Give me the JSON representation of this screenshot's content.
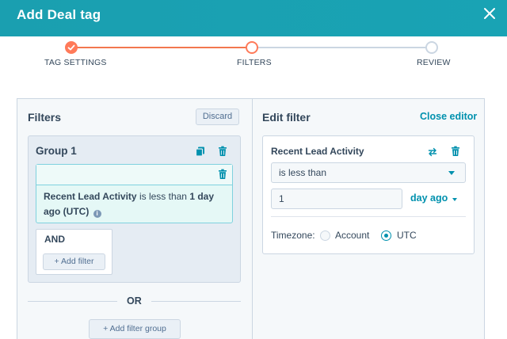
{
  "dialog": {
    "title": "Add Deal tag"
  },
  "stepper": {
    "steps": [
      {
        "label": "TAG SETTINGS",
        "state": "complete"
      },
      {
        "label": "FILTERS",
        "state": "active"
      },
      {
        "label": "REVIEW",
        "state": "upcoming"
      }
    ]
  },
  "filters_panel": {
    "title": "Filters",
    "discard_label": "Discard",
    "group": {
      "title": "Group 1",
      "filter": {
        "property": "Recent Lead Activity",
        "operator_text": "is less than",
        "value_text": "1 day ago (UTC)"
      },
      "and_label": "AND",
      "add_filter_label": "+ Add filter"
    },
    "or_label": "OR",
    "add_group_label": "+ Add filter group"
  },
  "editor": {
    "title": "Edit filter",
    "close_label": "Close editor",
    "property": "Recent Lead Activity",
    "operator": "is less than",
    "value": "1",
    "unit": "day ago",
    "timezone_label": "Timezone:",
    "timezone_options": [
      {
        "label": "Account",
        "selected": false
      },
      {
        "label": "UTC",
        "selected": true
      }
    ]
  },
  "colors": {
    "header": "#1a9fb0",
    "accent_orange": "#ff7a59",
    "link_teal": "#0091ae",
    "text": "#33475b"
  }
}
